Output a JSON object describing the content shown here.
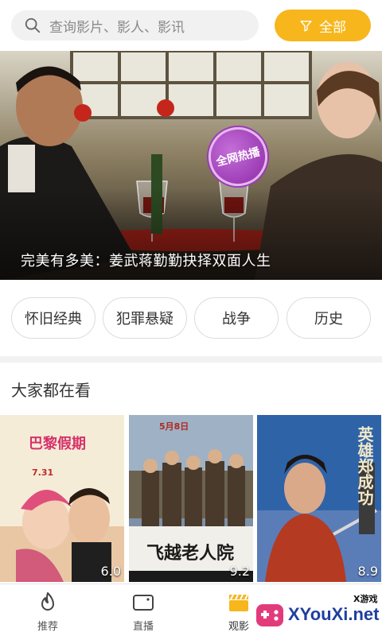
{
  "search": {
    "placeholder": "查询影片、影人、影讯"
  },
  "filter": {
    "label": "全部"
  },
  "banner": {
    "caption": "完美有多美：姜武蒋勤勤抉择双面人生",
    "stamp": "全网热播"
  },
  "categories": [
    "怀旧经典",
    "犯罪悬疑",
    "战争",
    "历史"
  ],
  "section": {
    "title": "大家都在看"
  },
  "posters": [
    {
      "score": "6.0",
      "title": "巴黎假期",
      "date": "7.31"
    },
    {
      "score": "9.2",
      "title": "飞越老人院",
      "date": "5月8日"
    },
    {
      "score": "8.9",
      "title": "英雄郑成功"
    }
  ],
  "nav": [
    {
      "label": "推荐",
      "icon": "flame-icon"
    },
    {
      "label": "直播",
      "icon": "tv-icon"
    },
    {
      "label": "观影",
      "icon": "clapperboard-icon"
    }
  ],
  "watermark": {
    "small": "X游戏",
    "big": "XYouXi.net"
  },
  "colors": {
    "accent": "#f7b61c",
    "stamp": "#9c3ab5",
    "text": "#333333"
  }
}
